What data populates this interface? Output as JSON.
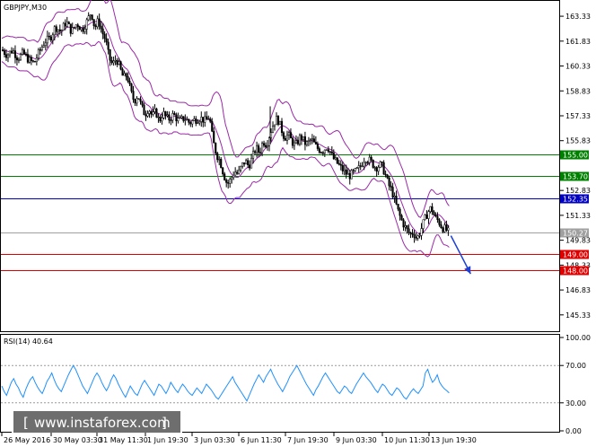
{
  "chart_data": [
    {
      "type": "candlestick",
      "title": "GBPJPY,M30",
      "y_ticks": [
        "163.33",
        "161.83",
        "160.33",
        "158.83",
        "157.33",
        "155.83",
        "152.83",
        "151.33",
        "149.83",
        "148.33",
        "146.83",
        "145.33"
      ],
      "ylim": [
        144.4,
        164.2
      ],
      "x_ticks": [
        "26 May 2016",
        "30 May 03:30",
        "31 May 11:30",
        "1 Jun 19:30",
        "3 Jun 03:30",
        "6 Jun 11:30",
        "7 Jun 19:30",
        "9 Jun 03:30",
        "10 Jun 11:30",
        "13 Jun 19:30"
      ],
      "price_path": [
        [
          0,
          161.3
        ],
        [
          6,
          161.0
        ],
        [
          12,
          161.3
        ],
        [
          18,
          160.8
        ],
        [
          24,
          161.1
        ],
        [
          30,
          160.7
        ],
        [
          36,
          160.5
        ],
        [
          42,
          161.2
        ],
        [
          48,
          161.8
        ],
        [
          54,
          162.0
        ],
        [
          60,
          162.7
        ],
        [
          66,
          162.4
        ],
        [
          72,
          163.0
        ],
        [
          78,
          162.4
        ],
        [
          84,
          162.9
        ],
        [
          90,
          162.5
        ],
        [
          95,
          163.0
        ],
        [
          100,
          163.6
        ],
        [
          104,
          162.6
        ],
        [
          108,
          163.1
        ],
        [
          112,
          162.4
        ],
        [
          116,
          161.9
        ],
        [
          120,
          160.8
        ],
        [
          124,
          160.4
        ],
        [
          128,
          160.8
        ],
        [
          132,
          160.2
        ],
        [
          136,
          159.6
        ],
        [
          140,
          159.8
        ],
        [
          144,
          158.8
        ],
        [
          148,
          158.2
        ],
        [
          152,
          158.6
        ],
        [
          156,
          157.9
        ],
        [
          160,
          157.4
        ],
        [
          164,
          157.8
        ],
        [
          168,
          157.3
        ],
        [
          172,
          157.6
        ],
        [
          176,
          157.0
        ],
        [
          180,
          157.5
        ],
        [
          186,
          157.1
        ],
        [
          192,
          157.4
        ],
        [
          198,
          157.0
        ],
        [
          204,
          157.2
        ],
        [
          210,
          156.9
        ],
        [
          216,
          157.1
        ],
        [
          222,
          157.2
        ],
        [
          228,
          157.0
        ],
        [
          232,
          157.3
        ],
        [
          236,
          155.8
        ],
        [
          240,
          155.0
        ],
        [
          244,
          154.6
        ],
        [
          248,
          153.8
        ],
        [
          252,
          153.2
        ],
        [
          256,
          153.5
        ],
        [
          260,
          154.0
        ],
        [
          264,
          153.8
        ],
        [
          268,
          154.3
        ],
        [
          272,
          154.6
        ],
        [
          276,
          154.3
        ],
        [
          280,
          154.8
        ],
        [
          284,
          155.4
        ],
        [
          288,
          155.1
        ],
        [
          292,
          155.8
        ],
        [
          296,
          155.6
        ],
        [
          300,
          156.3
        ],
        [
          304,
          156.9
        ],
        [
          308,
          157.2
        ],
        [
          312,
          156.6
        ],
        [
          316,
          156.0
        ],
        [
          320,
          156.2
        ],
        [
          324,
          155.8
        ],
        [
          328,
          155.5
        ],
        [
          334,
          156.1
        ],
        [
          340,
          155.6
        ],
        [
          346,
          155.9
        ],
        [
          352,
          155.4
        ],
        [
          358,
          155.2
        ],
        [
          364,
          155.5
        ],
        [
          370,
          154.8
        ],
        [
          376,
          154.4
        ],
        [
          382,
          154.0
        ],
        [
          388,
          153.7
        ],
        [
          394,
          153.9
        ],
        [
          400,
          154.2
        ],
        [
          406,
          154.8
        ],
        [
          412,
          154.6
        ],
        [
          418,
          154.2
        ],
        [
          424,
          154.4
        ],
        [
          428,
          153.9
        ],
        [
          432,
          153.2
        ],
        [
          436,
          152.8
        ],
        [
          440,
          152.1
        ],
        [
          444,
          151.4
        ],
        [
          448,
          150.9
        ],
        [
          452,
          150.5
        ],
        [
          456,
          150.2
        ],
        [
          460,
          150.3
        ],
        [
          464,
          149.9
        ],
        [
          468,
          150.4
        ],
        [
          472,
          151.0
        ],
        [
          476,
          151.5
        ],
        [
          480,
          151.8
        ],
        [
          484,
          151.2
        ],
        [
          488,
          151.0
        ],
        [
          492,
          150.6
        ],
        [
          496,
          150.5
        ],
        [
          500,
          150.27
        ]
      ],
      "h_levels": [
        {
          "value": 155.0,
          "label": "155.00",
          "color": "#008000"
        },
        {
          "value": 153.7,
          "label": "153.70",
          "color": "#008000"
        },
        {
          "value": 152.35,
          "label": "152.35",
          "color": "#0000c0"
        },
        {
          "value": 150.27,
          "label": "150.27",
          "color": "#a0a0a0"
        },
        {
          "value": 149.0,
          "label": "149.00",
          "color": "#e00000"
        },
        {
          "value": 148.0,
          "label": "148.00",
          "color": "#e00000"
        }
      ],
      "arrow": {
        "from": [
          502,
          150.1
        ],
        "to": [
          524,
          147.8
        ],
        "color": "#1c3fd6"
      },
      "band_color": "#9b2aa8"
    },
    {
      "type": "line",
      "title": "RSI(14) 40.64",
      "y_ticks": [
        "100.00",
        "70.00",
        "30.00",
        "0.00"
      ],
      "ylim": [
        0,
        100
      ],
      "color": "#1e90ff",
      "levels": [
        70,
        30
      ],
      "series": [
        {
          "values": [
            48,
            42,
            38,
            45,
            52,
            56,
            50,
            46,
            40,
            36,
            44,
            50,
            55,
            58,
            52,
            47,
            43,
            40,
            46,
            53,
            57,
            62,
            55,
            49,
            45,
            42,
            48,
            54,
            60,
            65,
            70,
            66,
            60,
            54,
            48,
            44,
            40,
            46,
            52,
            58,
            62,
            58,
            52,
            47,
            43,
            48,
            55,
            60,
            56,
            50,
            45,
            40,
            36,
            42,
            48,
            44,
            40,
            38,
            44,
            50,
            54,
            50,
            46,
            42,
            38,
            44,
            50,
            48,
            44,
            40,
            45,
            52,
            48,
            44,
            41,
            46,
            50,
            47,
            43,
            40,
            38,
            42,
            46,
            43,
            40,
            45,
            50,
            47,
            44,
            40,
            36,
            34,
            38,
            42,
            46,
            50,
            54,
            58,
            52,
            48,
            44,
            40,
            36,
            32,
            38,
            44,
            50,
            55,
            60,
            56,
            52,
            58,
            62,
            66,
            60,
            55,
            50,
            46,
            42,
            47,
            52,
            58,
            62,
            66,
            70,
            65,
            60,
            55,
            50,
            46,
            42,
            38,
            44,
            48,
            53,
            58,
            62,
            58,
            54,
            50,
            46,
            42,
            40,
            44,
            48,
            46,
            42,
            40,
            45,
            50,
            54,
            58,
            62,
            58,
            55,
            52,
            48,
            44,
            41,
            46,
            50,
            48,
            44,
            40,
            38,
            42,
            46,
            44,
            40,
            36,
            34,
            38,
            42,
            45,
            42,
            40,
            44,
            48,
            62,
            66,
            58,
            52,
            55,
            60,
            52,
            48,
            45,
            43,
            40.6
          ]
        }
      ]
    }
  ],
  "watermark": {
    "text": "www.instaforex.com"
  }
}
